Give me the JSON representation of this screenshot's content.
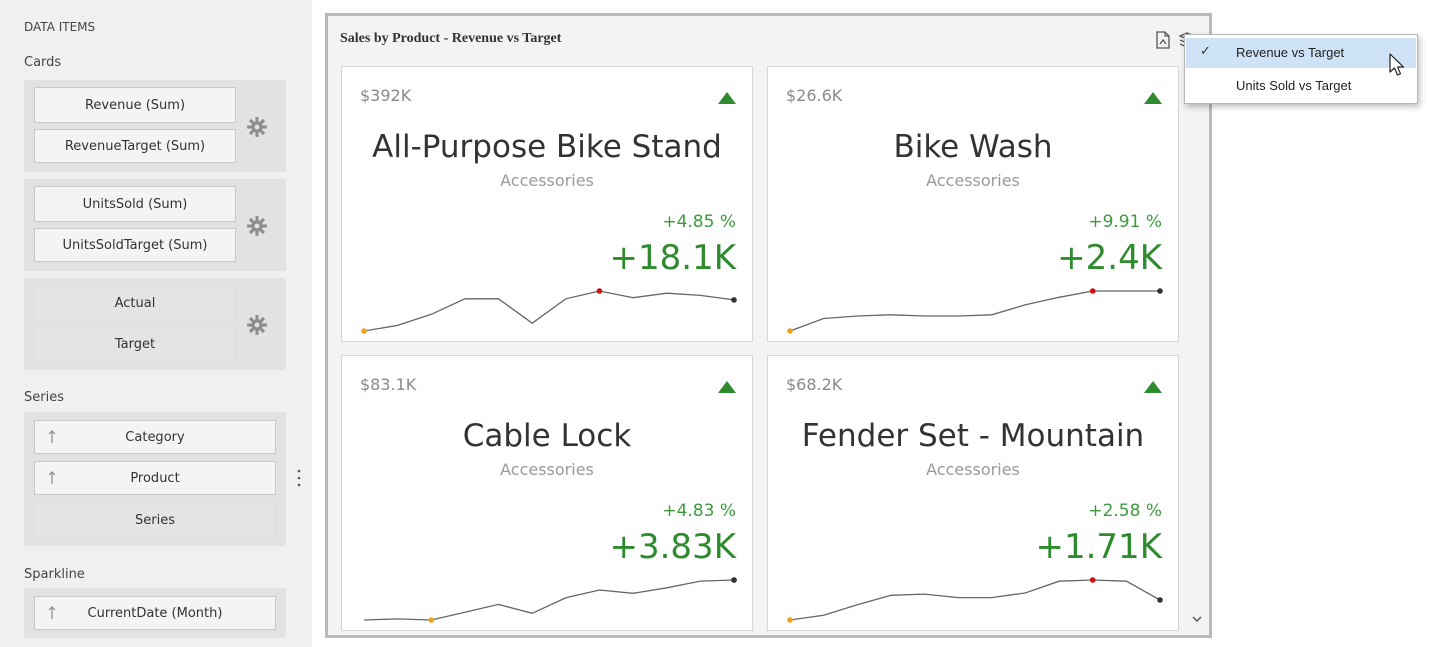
{
  "data_items": {
    "header": "DATA ITEMS",
    "cards_label": "Cards",
    "cards": [
      {
        "items": [
          "Revenue (Sum)",
          "RevenueTarget (Sum)"
        ]
      },
      {
        "items": [
          "UnitsSold (Sum)",
          "UnitsSoldTarget (Sum)"
        ]
      },
      {
        "items": [
          "Actual",
          "Target"
        ]
      }
    ],
    "series_label": "Series",
    "series": [
      "Category",
      "Product",
      "Series"
    ],
    "sparkline_label": "Sparkline",
    "sparkline": [
      "CurrentDate (Month)"
    ]
  },
  "dashboard": {
    "title": "Sales by Product - Revenue vs Target",
    "header_icons": [
      "export-icon",
      "layers-icon"
    ],
    "cards": [
      {
        "value": "$392K",
        "title": "All-Purpose Bike Stand",
        "subtitle": "Accessories",
        "percent": "+4.85 %",
        "delta": "+18.1K",
        "indicator": "up",
        "sparkline": [
          3,
          8,
          18,
          32,
          32,
          10,
          32,
          39,
          33,
          37,
          35,
          31
        ],
        "start_index": 0,
        "max_index": 7,
        "end_index": 11
      },
      {
        "value": "$26.6K",
        "title": "Bike Wash",
        "subtitle": "Accessories",
        "percent": "+9.91 %",
        "delta": "+2.4K",
        "indicator": "up",
        "sparkline": [
          2,
          12,
          14,
          15,
          14,
          14,
          15,
          23,
          29,
          34,
          34,
          34
        ],
        "start_index": 0,
        "max_index": 9,
        "end_index": 11
      },
      {
        "value": "$83.1K",
        "title": "Cable Lock",
        "subtitle": "Accessories",
        "percent": "+4.83 %",
        "delta": "+3.83K",
        "indicator": "up",
        "sparkline": [
          4,
          5,
          4,
          11,
          18,
          10,
          24,
          31,
          28,
          33,
          39,
          40
        ],
        "start_index": 2,
        "max_index": 11,
        "end_index": 11
      },
      {
        "value": "$68.2K",
        "title": "Fender Set - Mountain",
        "subtitle": "Accessories",
        "percent": "+2.58 %",
        "delta": "+1.71K",
        "indicator": "up",
        "sparkline": [
          2,
          6,
          15,
          23,
          24,
          21,
          21,
          25,
          35,
          36,
          35,
          19
        ],
        "start_index": 0,
        "max_index": 9,
        "end_index": 11
      }
    ]
  },
  "dropdown": {
    "items": [
      {
        "label": "Revenue vs Target",
        "checked": true
      },
      {
        "label": "Units Sold vs Target",
        "checked": false
      }
    ]
  },
  "colors": {
    "positive": "#2e8b2e",
    "sparkline": "#666666",
    "start_point": "#f0a020",
    "max_point": "#d01010",
    "end_point": "#333333",
    "selection": "#cfe3f6"
  }
}
